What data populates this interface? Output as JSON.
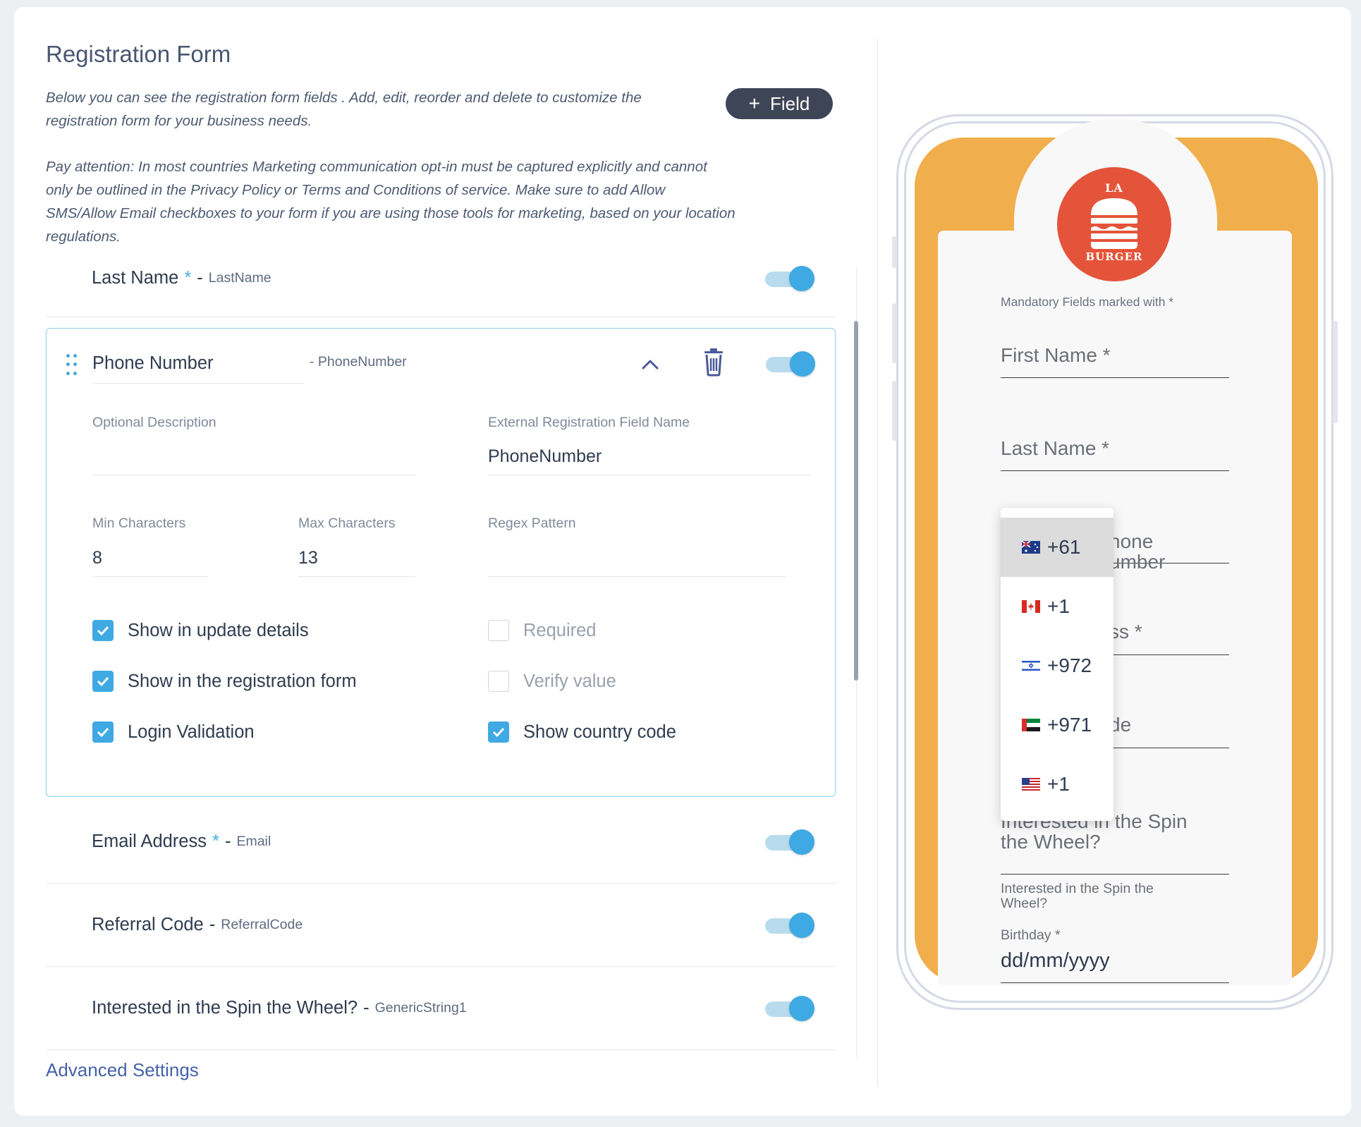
{
  "page": {
    "title": "Registration Form",
    "intro": "Below you can see the registration form fields . Add, edit, reorder and delete to customize the registration form for your business needs.",
    "notice": "Pay attention: In most countries Marketing communication opt-in must be captured explicitly and cannot only be outlined in the Privacy Policy or Terms and Conditions of service. Make sure to add Allow SMS/Allow Email checkboxes to your form if you are using those tools for marketing, based on your location regulations.",
    "add_field_label": "Field",
    "advanced_settings": "Advanced Settings"
  },
  "fields": {
    "last_name": {
      "label": "Last Name",
      "required_mark": "*",
      "separator": "-",
      "key": "LastName",
      "enabled": true
    },
    "phone": {
      "label": "Phone Number",
      "separator": "-",
      "key": "PhoneNumber",
      "enabled": true,
      "optional_description_label": "Optional Description",
      "optional_description_value": "",
      "external_name_label": "External Registration Field Name",
      "external_name_value": "PhoneNumber",
      "min_chars_label": "Min Characters",
      "min_chars_value": "8",
      "max_chars_label": "Max Characters",
      "max_chars_value": "13",
      "regex_label": "Regex Pattern",
      "regex_value": "",
      "options": [
        {
          "label": "Show in update details",
          "checked": true
        },
        {
          "label": "Show in the registration form",
          "checked": true
        },
        {
          "label": "Login Validation",
          "checked": true
        },
        {
          "label": "Required",
          "checked": false
        },
        {
          "label": "Verify value",
          "checked": false
        },
        {
          "label": "Show country code",
          "checked": true
        }
      ]
    },
    "email": {
      "label": "Email Address",
      "required_mark": "*",
      "separator": "-",
      "key": "Email",
      "enabled": true
    },
    "referral": {
      "label": "Referral Code",
      "separator": "-",
      "key": "ReferralCode",
      "enabled": true
    },
    "spin": {
      "label": "Interested in the Spin the Wheel?",
      "separator": "-",
      "key": "GenericString1",
      "enabled": true
    }
  },
  "preview": {
    "logo_top": "LA",
    "logo_bottom": "BURGER",
    "mandatory_note": "Mandatory Fields marked with *",
    "first_name": "First Name *",
    "last_name": "Last Name *",
    "phone_line1": "hone",
    "phone_line2": "umber",
    "email_fragment": "ss *",
    "code_fragment": "de",
    "spin_line1": "Interested in the Spin",
    "spin_line2": "the Wheel?",
    "spin_small_1": "Interested in the Spin the",
    "spin_small_2": "Wheel?",
    "birthday_label": "Birthday *",
    "birthday_placeholder": "dd/mm/yyyy",
    "country_codes": [
      {
        "code": "+61",
        "flag": "australia-flag-icon",
        "active": true
      },
      {
        "code": "+1",
        "flag": "canada-flag-icon",
        "active": false
      },
      {
        "code": "+972",
        "flag": "israel-flag-icon",
        "active": false
      },
      {
        "code": "+971",
        "flag": "uae-flag-icon",
        "active": false
      },
      {
        "code": "+1",
        "flag": "usa-flag-icon",
        "active": false
      }
    ]
  },
  "colors": {
    "accent": "#3fa9e3",
    "brand_orange": "#f1ae4d",
    "logo_red": "#e4543a",
    "button_dark": "#3e4557",
    "link": "#4561a8"
  }
}
